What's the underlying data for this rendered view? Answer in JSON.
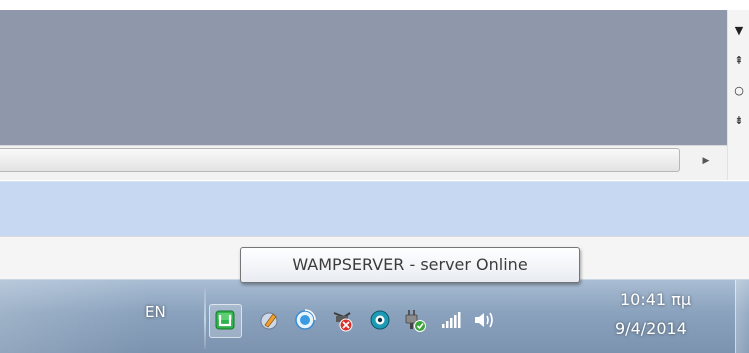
{
  "tooltip": {
    "text": "WAMPSERVER - server Online"
  },
  "taskbar": {
    "language": "EN",
    "clock_time": "10:41 πμ",
    "clock_date": "9/4/2014"
  },
  "tray_icons": [
    "wampserver-icon",
    "media-icon",
    "update-icon",
    "network-disconnected-icon",
    "camera-icon",
    "power-plug-icon",
    "signal-bars-icon",
    "speaker-icon"
  ],
  "colors": {
    "window_gray": "#8f98ab",
    "highlight_blue": "#c6d8f2",
    "wamp_green": "#2db34a",
    "taskbar": "#8aa2bd"
  }
}
